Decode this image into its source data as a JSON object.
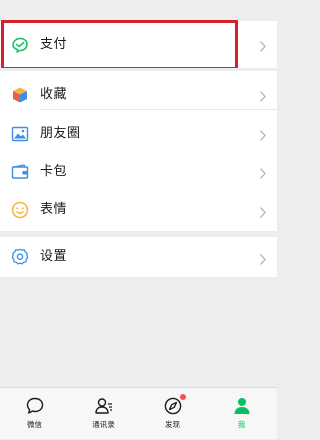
{
  "menu": {
    "pay": {
      "label": "支付",
      "icon": "pay-icon"
    },
    "favorites": {
      "label": "收藏",
      "icon": "favorites-cube-icon"
    },
    "moments": {
      "label": "朋友圈",
      "icon": "moments-photo-icon"
    },
    "cards": {
      "label": "卡包",
      "icon": "wallet-icon"
    },
    "stickers": {
      "label": "表情",
      "icon": "smiley-icon"
    },
    "settings": {
      "label": "设置",
      "icon": "gear-icon"
    }
  },
  "tabs": [
    {
      "label": "微信",
      "icon": "chat-bubble-icon",
      "active": false
    },
    {
      "label": "通讯录",
      "icon": "contacts-icon",
      "active": false
    },
    {
      "label": "发现",
      "icon": "compass-icon",
      "active": false,
      "badge": true
    },
    {
      "label": "我",
      "icon": "person-icon",
      "active": true
    }
  ],
  "colors": {
    "accent": "#07c160",
    "highlight": "#d8202a",
    "badge": "#fa5151",
    "background": "#ededed"
  }
}
